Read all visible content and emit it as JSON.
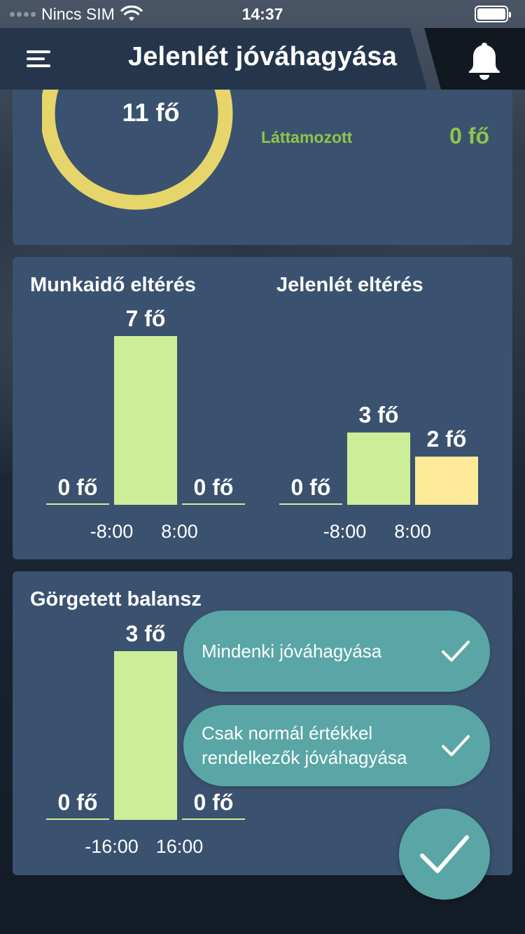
{
  "status_bar": {
    "carrier": "Nincs SIM",
    "time": "14:37"
  },
  "nav": {
    "title": "Jelenlét jóváhagyása",
    "icons": [
      "menu-icon",
      "bell-icon"
    ]
  },
  "summary": {
    "ring_value": "11 fő",
    "seen_label": "Láttamozott",
    "seen_value": "0 fő",
    "ring_color": "#e6d56a",
    "seen_color": "#8fc54a"
  },
  "colors": {
    "card": "#3a526f",
    "green_bar": "#cdee98",
    "yellow_bar": "#fdeb99",
    "accent": "#5aa6a6"
  },
  "chart_data": [
    {
      "type": "bar",
      "title": "Munkaidő eltérés",
      "categories": [
        "< -8:00",
        "-8:00 – 8:00",
        "> 8:00"
      ],
      "tick_labels": [
        "-8:00",
        "8:00"
      ],
      "values": [
        0,
        7,
        0
      ],
      "value_labels": [
        "0 fő",
        "7 fő",
        "0 fő"
      ],
      "bar_colors": [
        "#cdee98",
        "#cdee98",
        "#cdee98"
      ],
      "ylim": [
        0,
        7
      ]
    },
    {
      "type": "bar",
      "title": "Jelenlét eltérés",
      "categories": [
        "< -8:00",
        "-8:00 – 8:00",
        "> 8:00"
      ],
      "tick_labels": [
        "-8:00",
        "8:00"
      ],
      "values": [
        0,
        3,
        2
      ],
      "value_labels": [
        "0 fő",
        "3 fő",
        "2 fő"
      ],
      "bar_colors": [
        "#cdee98",
        "#cdee98",
        "#fdeb99"
      ],
      "ylim": [
        0,
        7
      ]
    },
    {
      "type": "bar",
      "title": "Görgetett balansz",
      "categories": [
        "< -16:00",
        "-16:00 – 16:00",
        "> 16:00"
      ],
      "tick_labels": [
        "-16:00",
        "16:00"
      ],
      "values": [
        0,
        3,
        0
      ],
      "value_labels": [
        "0 fő",
        "3 fő",
        "0 fő"
      ],
      "bar_colors": [
        "#cdee98",
        "#cdee98",
        "#cdee98"
      ],
      "ylim": [
        0,
        3
      ]
    }
  ],
  "actions": {
    "approve_all": "Mindenki jóváhagyása",
    "approve_normal": "Csak normál értékkel rendelkezők jóváhagyása"
  }
}
